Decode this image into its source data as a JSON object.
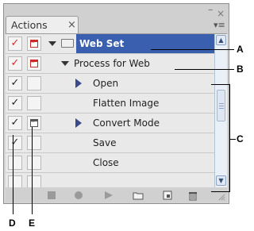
{
  "panel": {
    "tab_label": "Actions",
    "tab_close": "×",
    "window_close": "×",
    "window_minimize": "–",
    "panel_menu": "▾≡"
  },
  "rows": [
    {
      "toggle": "✓",
      "dialog": "red-dialog-icon",
      "label": "Web Set",
      "type": "set"
    },
    {
      "toggle": "✓",
      "dialog": "red-dialog-icon",
      "label": "Process for Web",
      "type": "action"
    },
    {
      "toggle": "✓",
      "dialog": "",
      "label": "Open",
      "type": "command",
      "expandable": true
    },
    {
      "toggle": "✓",
      "dialog": "",
      "label": "Flatten Image",
      "type": "command",
      "expandable": false
    },
    {
      "toggle": "✓",
      "dialog": "dialog-icon",
      "label": "Convert Mode",
      "type": "command",
      "expandable": true
    },
    {
      "toggle": "✓",
      "dialog": "",
      "label": "Save",
      "type": "command",
      "expandable": false
    },
    {
      "toggle": "",
      "dialog": "",
      "label": "Close",
      "type": "command",
      "expandable": false
    }
  ],
  "callouts": {
    "a": "A",
    "b": "B",
    "c": "C",
    "d": "D",
    "e": "E"
  },
  "colors": {
    "selection": "#3a5fae",
    "checkmark_red": "#cc2a2a"
  }
}
